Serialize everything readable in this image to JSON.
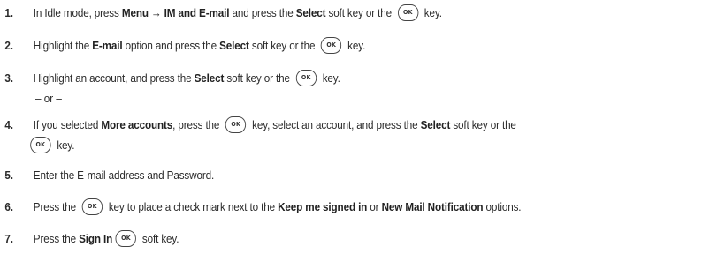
{
  "ok_key_label": "OK",
  "steps": [
    {
      "num": "1.",
      "parts": [
        "In Idle mode, press ",
        "Menu",
        " ",
        "→",
        " ",
        "IM and E-mail",
        " and press the ",
        "Select",
        " soft key or the ",
        " key."
      ]
    },
    {
      "num": "2.",
      "parts": [
        "Highlight the ",
        "E-mail",
        " option and press the ",
        "Select",
        " soft key or the ",
        " key."
      ]
    },
    {
      "num": "3.",
      "parts": [
        "Highlight an account, and press the ",
        "Select",
        " soft key or the ",
        " key."
      ]
    },
    {
      "num": "4.",
      "parts": [
        "If you selected ",
        "More accounts",
        ", press the ",
        " key, select an account, and press the ",
        "Select",
        " soft key or the",
        " key."
      ]
    },
    {
      "num": "5.",
      "parts": [
        "Enter the E-mail address and Password."
      ]
    },
    {
      "num": "6.",
      "parts": [
        "Press the ",
        " key to place a check mark next to the ",
        "Keep me signed in",
        " or ",
        "New Mail Notification",
        " options."
      ]
    },
    {
      "num": "7.",
      "parts": [
        "Press the ",
        "Sign In",
        " soft key."
      ]
    }
  ],
  "or_separator": "– or –"
}
